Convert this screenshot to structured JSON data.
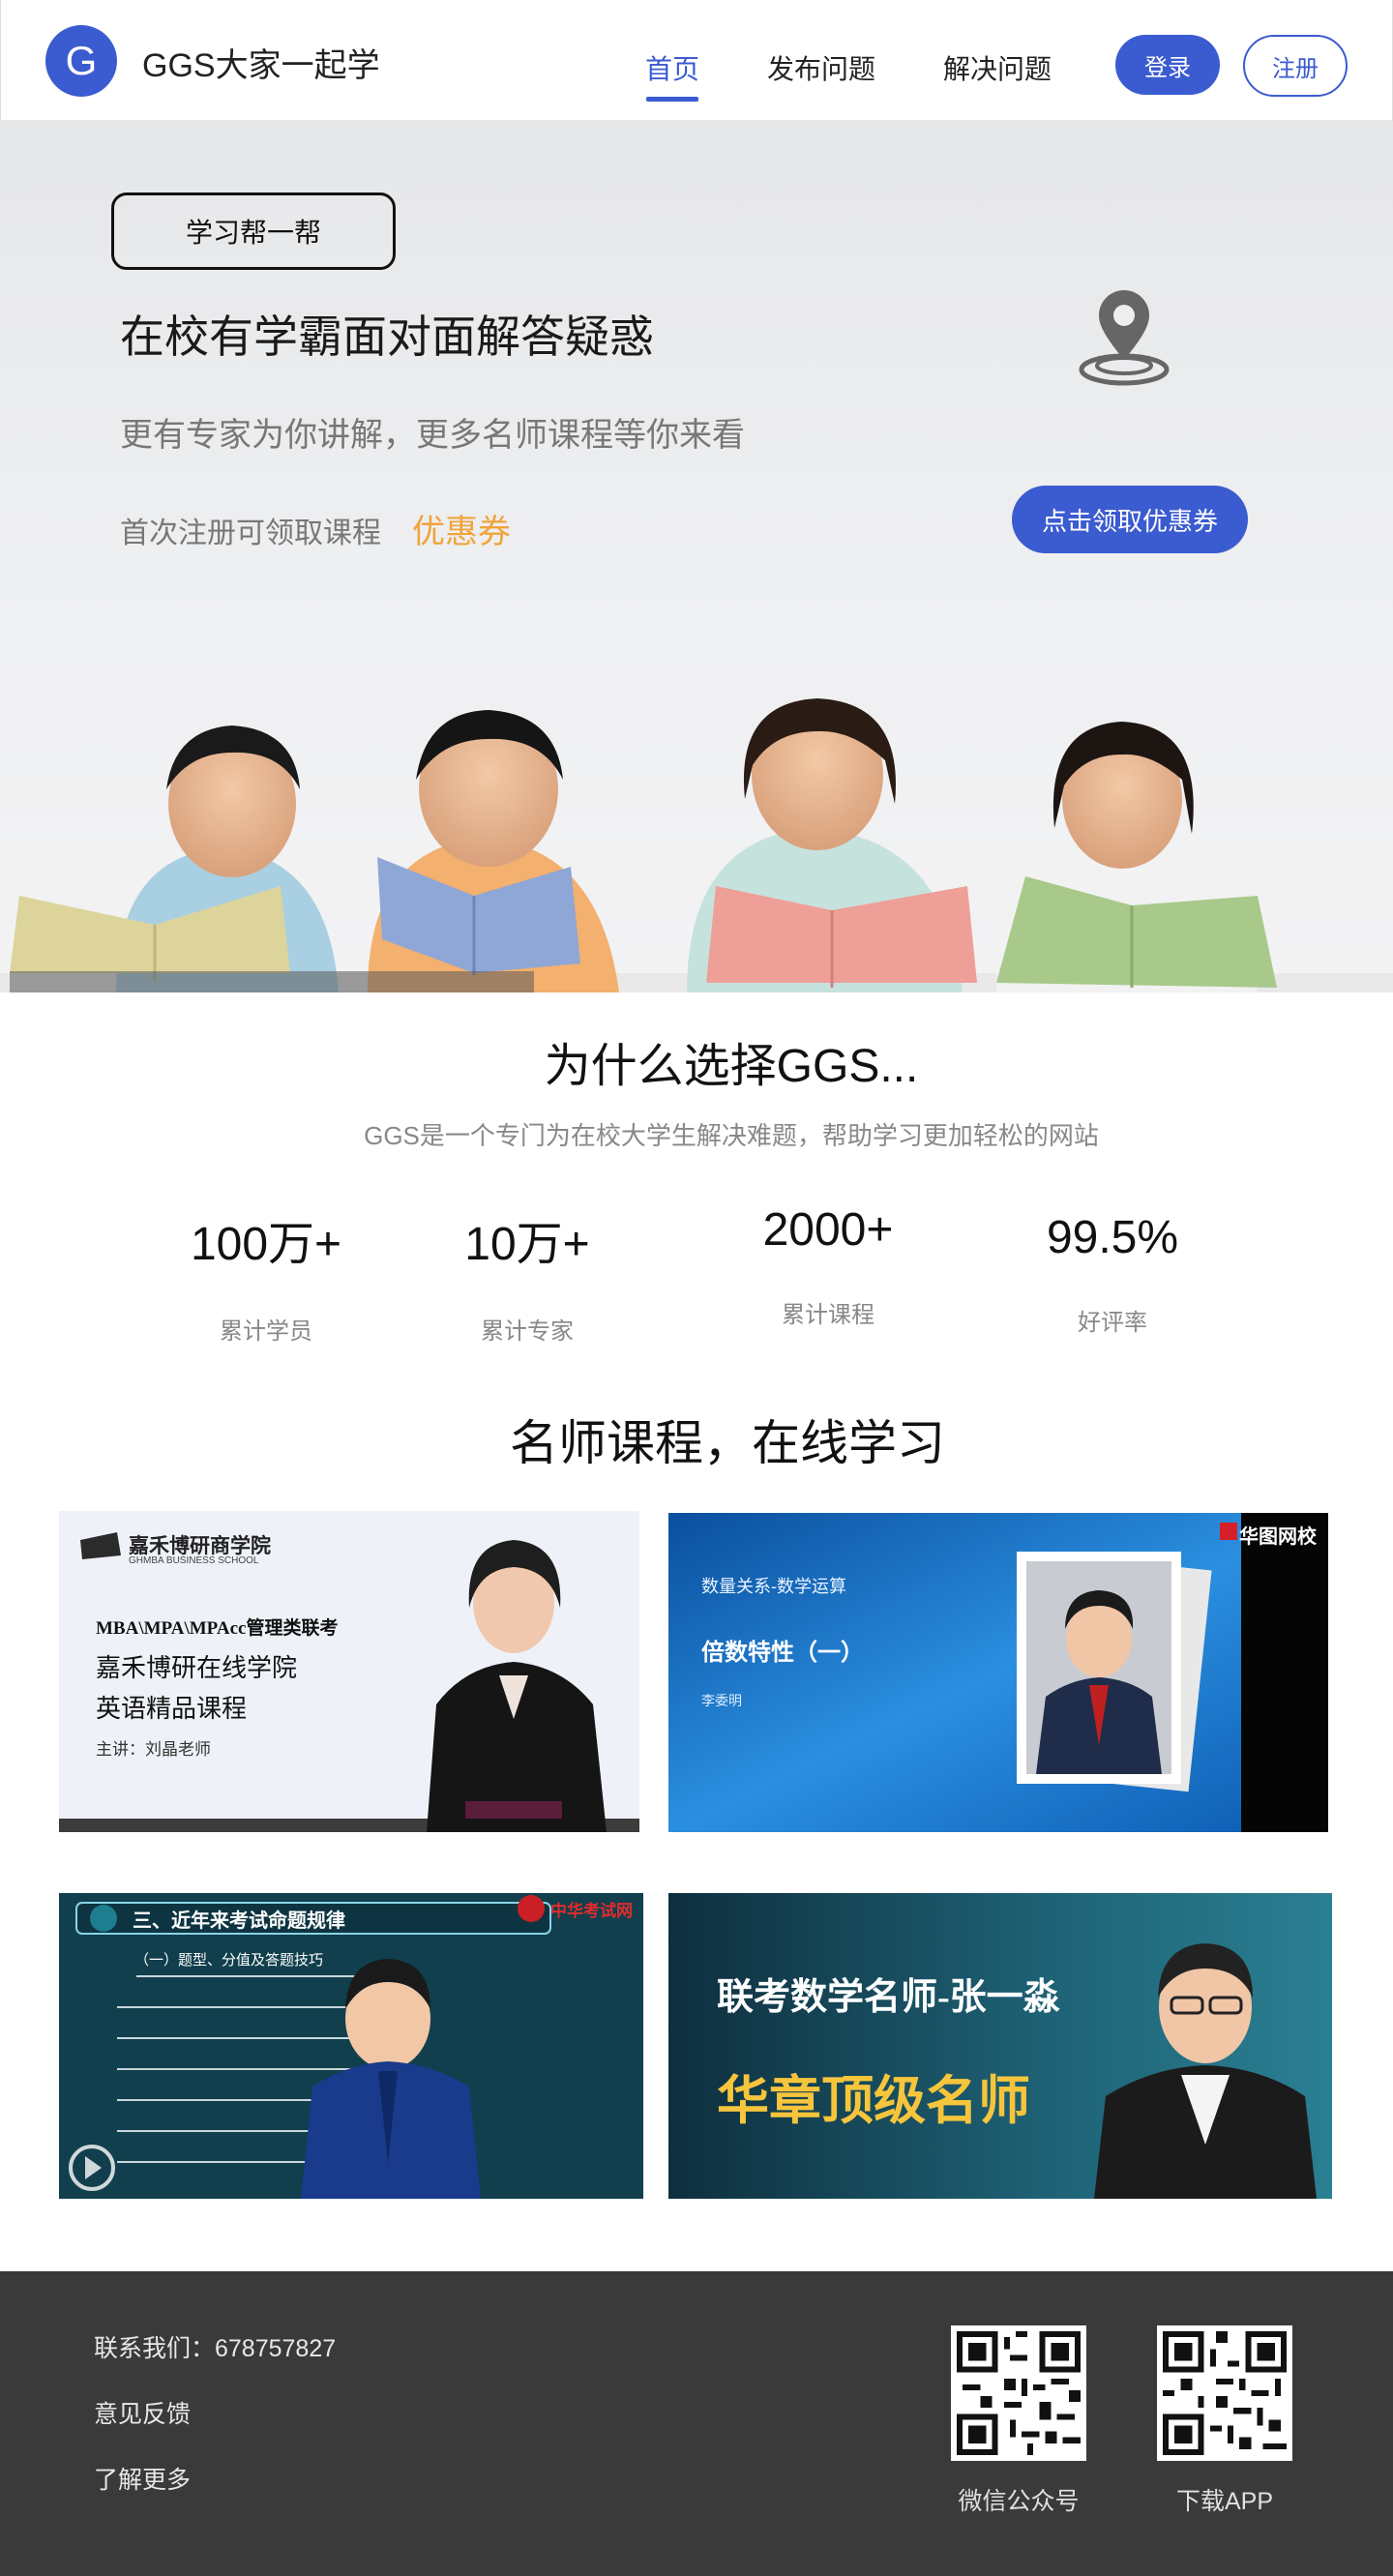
{
  "header": {
    "logo_letter": "G",
    "brand": "GGS大家一起学",
    "nav": [
      "首页",
      "发布问题",
      "解决问题"
    ],
    "login": "登录",
    "register": "注册"
  },
  "hero": {
    "tag": "学习帮一帮",
    "title": "在校有学霸面对面解答疑惑",
    "subtitle": "更有专家为你讲解，更多名师课程等你来看",
    "note": "首次注册可领取课程",
    "coupon": "优惠券",
    "cta": "点击领取优惠券"
  },
  "why": {
    "title": "为什么选择GGS...",
    "desc": "GGS是一个专门为在校大学生解决难题，帮助学习更加轻松的网站",
    "stats": [
      {
        "num": "100万+",
        "label": "累计学员"
      },
      {
        "num": "10万+",
        "label": "累计专家"
      },
      {
        "num": "2000+",
        "label": "累计课程"
      },
      {
        "num": "99.5%",
        "label": "好评率"
      }
    ]
  },
  "courses": {
    "title": "名师课程，在线学习",
    "card1": {
      "school": "嘉禾博研商学院",
      "school_en": "GHMBA BUSINESS SCHOOL",
      "exam": "MBA\\MPA\\MPAcc管理类联考",
      "line1": "嘉禾博研在线学院",
      "line2": "英语精品课程",
      "teacher": "主讲：刘晶老师"
    },
    "card2": {
      "brand": "华图网校",
      "topic": "数量关系-数学运算",
      "lesson": "倍数特性（一）",
      "teacher": "李委明"
    },
    "card3": {
      "heading": "三、近年来考试命题规律",
      "brand": "中华考试网",
      "body": "（一）题型、分值及答题技巧"
    },
    "card4": {
      "line1": "联考数学名师-张一淼",
      "line2": "华章顶级名师"
    }
  },
  "footer": {
    "contact": "联系我们：678757827",
    "feedback": "意见反馈",
    "more": "了解更多",
    "qr1": "微信公众号",
    "qr2": "下载APP"
  },
  "colors": {
    "primary": "#3b5bd0",
    "accent": "#f0a33a",
    "footer_bg": "#3a3a3a"
  }
}
